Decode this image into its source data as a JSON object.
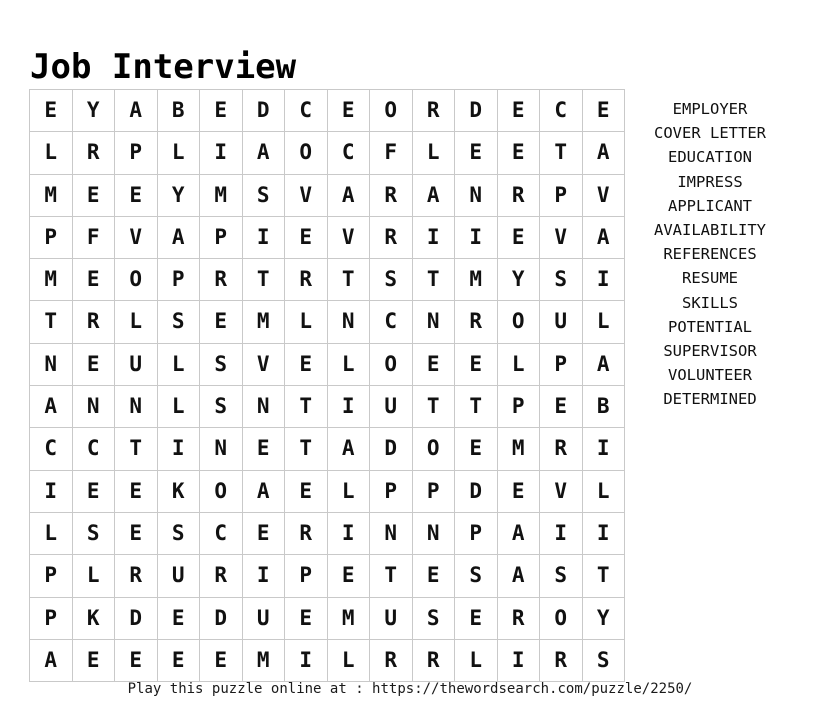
{
  "title": "Job Interview",
  "grid": {
    "rows": 14,
    "cols": 14,
    "letters": [
      [
        "E",
        "Y",
        "A",
        "B",
        "E",
        "D",
        "C",
        "E",
        "O",
        "R",
        "D",
        "E",
        "C",
        "E"
      ],
      [
        "L",
        "R",
        "P",
        "L",
        "I",
        "A",
        "O",
        "C",
        "F",
        "L",
        "E",
        "E",
        "T",
        "A"
      ],
      [
        "M",
        "E",
        "E",
        "Y",
        "M",
        "S",
        "V",
        "A",
        "R",
        "A",
        "N",
        "R",
        "P",
        "V"
      ],
      [
        "P",
        "F",
        "V",
        "A",
        "P",
        "I",
        "E",
        "V",
        "R",
        "I",
        "I",
        "E",
        "V",
        "A"
      ],
      [
        "M",
        "E",
        "O",
        "P",
        "R",
        "T",
        "R",
        "T",
        "S",
        "T",
        "M",
        "Y",
        "S",
        "I"
      ],
      [
        "T",
        "R",
        "L",
        "S",
        "E",
        "M",
        "L",
        "N",
        "C",
        "N",
        "R",
        "O",
        "U",
        "L"
      ],
      [
        "N",
        "E",
        "U",
        "L",
        "S",
        "V",
        "E",
        "L",
        "O",
        "E",
        "E",
        "L",
        "P",
        "A"
      ],
      [
        "A",
        "N",
        "N",
        "L",
        "S",
        "N",
        "T",
        "I",
        "U",
        "T",
        "T",
        "P",
        "E",
        "B"
      ],
      [
        "C",
        "C",
        "T",
        "I",
        "N",
        "E",
        "T",
        "A",
        "D",
        "O",
        "E",
        "M",
        "R",
        "I"
      ],
      [
        "I",
        "E",
        "E",
        "K",
        "O",
        "A",
        "E",
        "L",
        "P",
        "P",
        "D",
        "E",
        "V",
        "L"
      ],
      [
        "L",
        "S",
        "E",
        "S",
        "C",
        "E",
        "R",
        "I",
        "N",
        "N",
        "P",
        "A",
        "I",
        "I"
      ],
      [
        "P",
        "L",
        "R",
        "U",
        "R",
        "I",
        "P",
        "E",
        "T",
        "E",
        "S",
        "A",
        "S",
        "T"
      ],
      [
        "P",
        "K",
        "D",
        "E",
        "D",
        "U",
        "E",
        "M",
        "U",
        "S",
        "E",
        "R",
        "O",
        "Y"
      ],
      [
        "A",
        "E",
        "E",
        "E",
        "E",
        "M",
        "I",
        "L",
        "R",
        "R",
        "L",
        "I",
        "R",
        "S"
      ]
    ]
  },
  "word_list": {
    "words": [
      "EMPLOYER",
      "COVER LETTER",
      "EDUCATION",
      "IMPRESS",
      "APPLICANT",
      "AVAILABILITY",
      "REFERENCES",
      "RESUME",
      "SKILLS",
      "POTENTIAL",
      "SUPERVISOR",
      "VOLUNTEER",
      "DETERMINED"
    ]
  },
  "footer": {
    "text": "Play this puzzle online at : https://thewordsearch.com/puzzle/2250/"
  },
  "colors": {
    "background": "#ffffff",
    "text": "#000000",
    "grid_border": "#c9c9c9"
  }
}
